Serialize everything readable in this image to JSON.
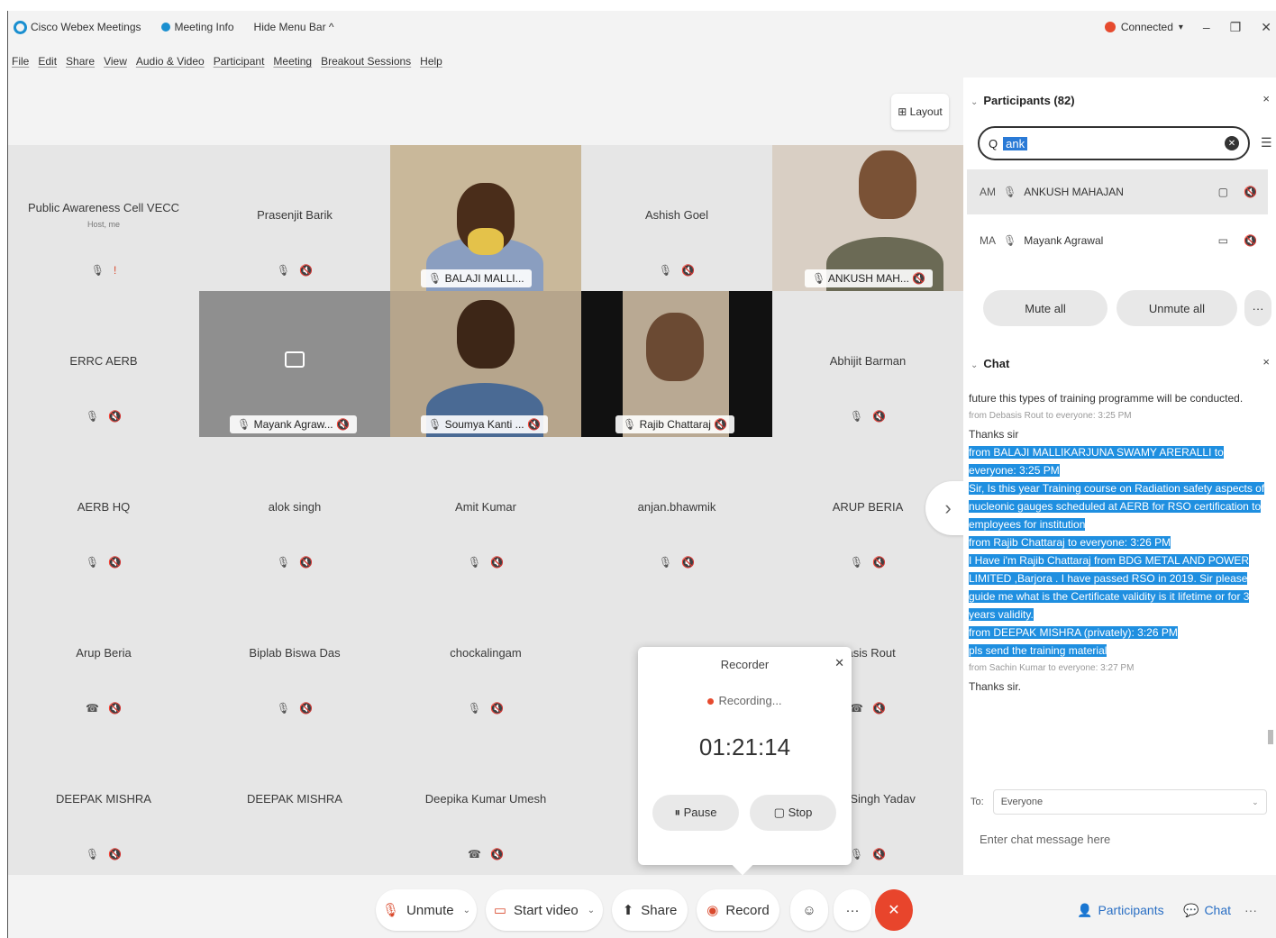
{
  "titlebar": {
    "app_name": "Cisco Webex Meetings",
    "meeting_info": "Meeting Info",
    "hide_menu": "Hide Menu Bar ^",
    "status": "Connected",
    "status_caret": "▾",
    "minimize": "–",
    "restore": "❐",
    "close": "✕"
  },
  "menu": [
    "File",
    "Edit",
    "Share",
    "View",
    "Audio & Video",
    "Participant",
    "Meeting",
    "Breakout Sessions",
    "Help"
  ],
  "layout_button": "⊞ Layout",
  "tiles": [
    {
      "name": "Public Awareness Cell VECC",
      "sub": "Host, me",
      "mic": "🎙",
      "mute": "!"
    },
    {
      "name": "Prasenjit Barik",
      "mic": "🎙",
      "mute": "🔇"
    },
    {
      "label": "BALAJI MALLI...",
      "mic": "🎙"
    },
    {
      "name": "Ashish Goel",
      "mic": "🎙",
      "mute": "🔇"
    },
    {
      "label": "ANKUSH MAH...",
      "mic": "🎙",
      "mute": "🔇"
    },
    {
      "name": "ERRC AERB",
      "mic": "🎙",
      "mute": "🔇"
    },
    {
      "label": "Mayank Agraw...",
      "mic": "🎙",
      "mute": "🔇"
    },
    {
      "label": "Soumya Kanti ...",
      "mic": "🎙",
      "mute": "🔇"
    },
    {
      "label": "Rajib Chattaraj",
      "mic": "🎙",
      "mute": "🔇"
    },
    {
      "name": "Abhijit Barman",
      "mic": "🎙",
      "mute": "🔇"
    },
    {
      "name": "AERB HQ",
      "mic": "🎙",
      "mute": "🔇"
    },
    {
      "name": "alok singh",
      "mic": "🎙",
      "mute": "🔇"
    },
    {
      "name": "Amit Kumar",
      "mic": "🎙",
      "mute": "🔇"
    },
    {
      "name": "anjan.bhawmik",
      "mic": "🎙",
      "mute": "🔇"
    },
    {
      "name": "ARUP BERIA",
      "mic": "🎙",
      "mute": "🔇"
    },
    {
      "name": "Arup Beria",
      "mic": "☎",
      "mute": "🔇"
    },
    {
      "name": "Biplab Biswa Das",
      "mic": "🎙",
      "mute": "🔇"
    },
    {
      "name": "chockalingam",
      "mic": "🎙",
      "mute": "🔇"
    },
    {
      "name": "",
      "mic": "",
      "mute": ""
    },
    {
      "name": "basis Rout",
      "mic": "☎",
      "mute": "🔇"
    },
    {
      "name": "DEEPAK MISHRA",
      "mic": "🎙",
      "mute": "🔇"
    },
    {
      "name": "DEEPAK MISHRA",
      "mic": "",
      "mute": ""
    },
    {
      "name": "Deepika Kumar Umesh",
      "mic": "☎",
      "mute": "🔇"
    },
    {
      "name": "",
      "mic": "",
      "mute": ""
    },
    {
      "name": "umar Singh Yadav",
      "mic": "🎙",
      "mute": "🔇"
    }
  ],
  "next_arrow": "›",
  "recorder": {
    "title": "Recorder",
    "close": "✕",
    "status": "Recording...",
    "time": "01:21:14",
    "pause": "⏸ Pause",
    "stop": "▢ Stop"
  },
  "toolbar": {
    "unmute": "Unmute",
    "unmute_icon": "🎙",
    "start_video": "Start video",
    "start_video_icon": "▭",
    "share": "Share",
    "share_icon": "⬆",
    "record": "Record",
    "record_icon": "◉",
    "reactions_icon": "☺",
    "more": "···",
    "end": "✕",
    "caret": "⌄"
  },
  "participants": {
    "header": "Participants (82)",
    "close": "×",
    "search_value": "ank",
    "search_icon": "Q",
    "clear_icon": "✕",
    "sort_icon": "☰",
    "rows": [
      {
        "initials": "AM",
        "name": "ANKUSH MAHAJAN",
        "cam": "▢",
        "mute": "🔇"
      },
      {
        "initials": "MA",
        "name": "Mayank Agrawal",
        "cam": "▭",
        "mute": "🔇"
      }
    ],
    "mute_all": "Mute all",
    "unmute_all": "Unmute all",
    "more": "···"
  },
  "chat": {
    "header": "Chat",
    "close": "×",
    "messages": [
      {
        "type": "text",
        "text": "future this types of training programme will be conducted."
      },
      {
        "type": "meta",
        "text": "from Debasis Rout to everyone:   3:25 PM"
      },
      {
        "type": "text",
        "text": "Thanks sir"
      },
      {
        "type": "hl",
        "text": "from BALAJI MALLIKARJUNA SWAMY ARERALLI to everyone:   3:25 PM"
      },
      {
        "type": "hl",
        "text": "Sir, Is this year Training course on Radiation safety aspects of nucleonic gauges scheduled at AERB for RSO certification to employees for institution"
      },
      {
        "type": "hl",
        "text": "from Rajib Chattaraj to everyone:   3:26 PM"
      },
      {
        "type": "hl",
        "text": "I Have i'm Rajib Chattaraj from BDG METAL AND POWER LIMITED ,Barjora . I have passed RSO in 2019. Sir please guide me what is the Certificate validity is it lifetime or for 3 years validity."
      },
      {
        "type": "hl",
        "text": "from DEEPAK MISHRA (privately):   3:26 PM"
      },
      {
        "type": "hl",
        "text": "pls send the training material"
      },
      {
        "type": "meta",
        "text": "from Sachin Kumar to everyone:   3:27 PM"
      },
      {
        "type": "text",
        "text": "Thanks sir."
      }
    ],
    "to_label": "To:",
    "to_value": "Everyone",
    "to_caret": "⌄",
    "input_placeholder": "Enter chat message here"
  },
  "bottom_right": {
    "participants": "Participants",
    "participants_icon": "👤",
    "chat": "Chat",
    "chat_icon": "💬",
    "more": "···"
  }
}
